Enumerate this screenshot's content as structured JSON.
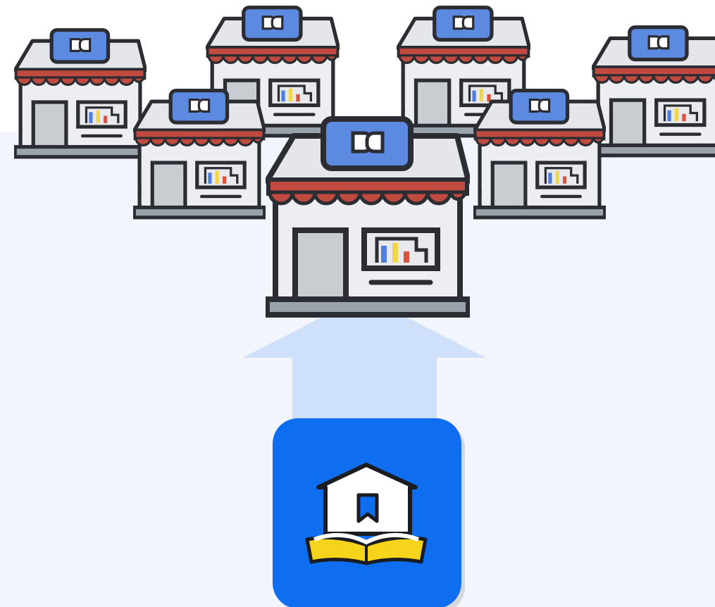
{
  "colors": {
    "background_top": "#ffffff",
    "background_panel": "#f2f6fc",
    "outline": "#2b2d33",
    "store_wall": "#eceef1",
    "store_roof": "#e4e6ea",
    "awning": "#c04a3f",
    "sign": "#5b8ae0",
    "door": "#c8cdd2",
    "window": "#e7e9ec",
    "base": "#9aa3ab",
    "item_blue": "#4f7ee0",
    "item_yellow": "#f1d54a",
    "item_red": "#d6533e",
    "arrow": "#cfe0fb",
    "app_tile": "#0f6df0",
    "app_book": "#f7d41c"
  },
  "icons": {
    "central_store": "storefront-icon",
    "side_stores": "storefront-icon",
    "arrow": "arrow-up-icon",
    "app": "bookstore-app-icon"
  },
  "store_count": 7
}
